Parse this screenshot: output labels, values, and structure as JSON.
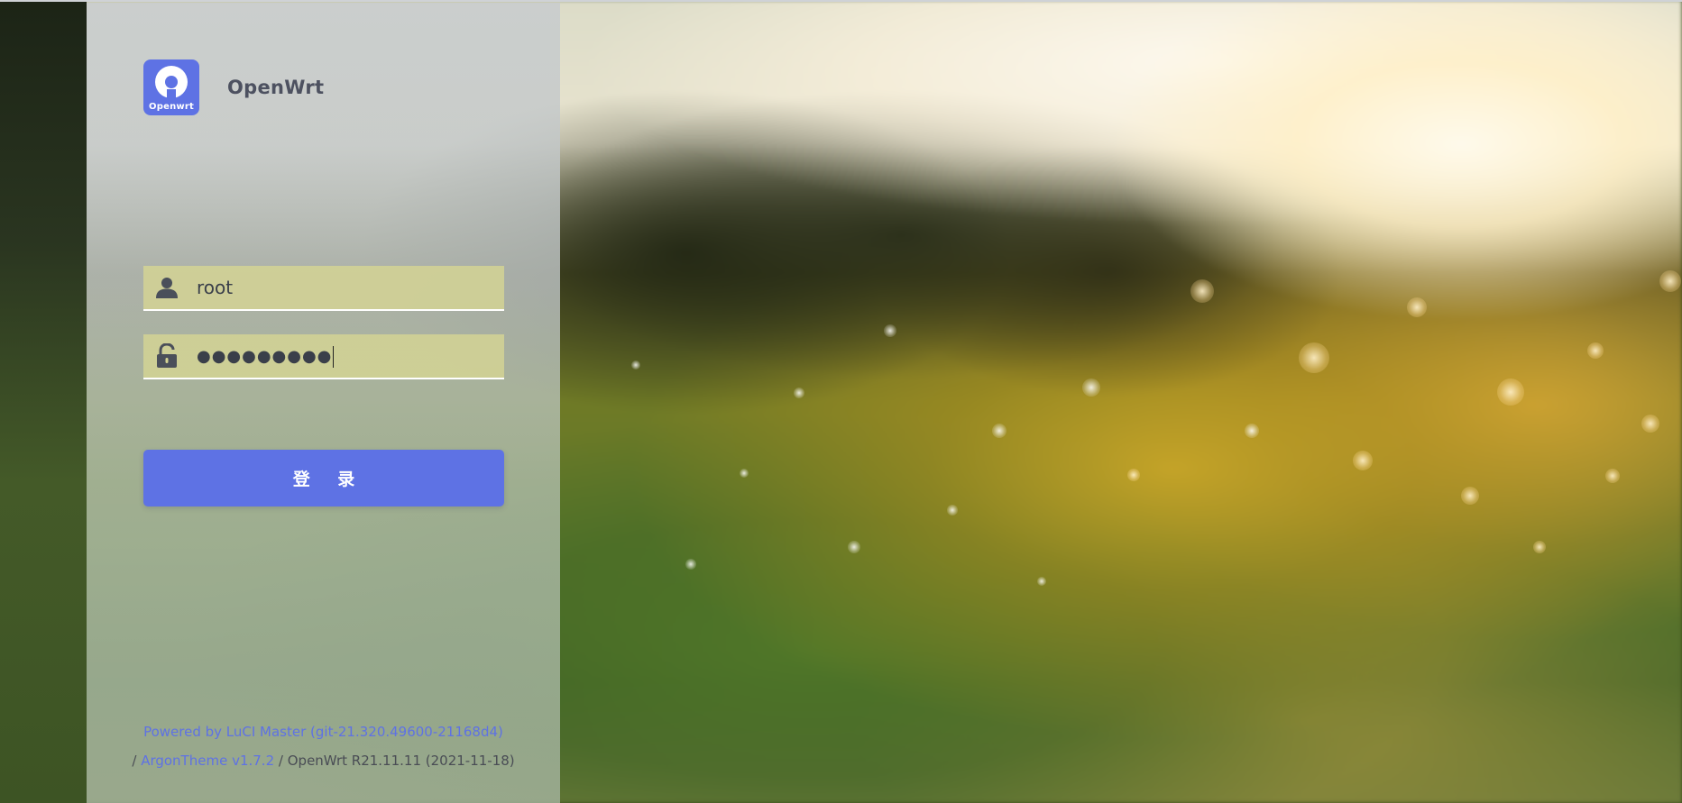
{
  "brand": {
    "logo_text": "Openwrt",
    "name": "OpenWrt",
    "accent_color": "#5e72e4"
  },
  "login_form": {
    "username": {
      "icon": "user-icon",
      "value": "root"
    },
    "password": {
      "icon": "unlock-icon",
      "masked_value": "●●●●●●●●●"
    },
    "submit_label": "登 录"
  },
  "footer": {
    "powered_by_link": "Powered by LuCI Master (git-21.320.49600-21168d4)",
    "separator_1": "/",
    "theme_link": "ArgonTheme v1.7.2",
    "separator_2": "/",
    "version_text": "OpenWrt R21.11.11 (2021-11-18)"
  }
}
